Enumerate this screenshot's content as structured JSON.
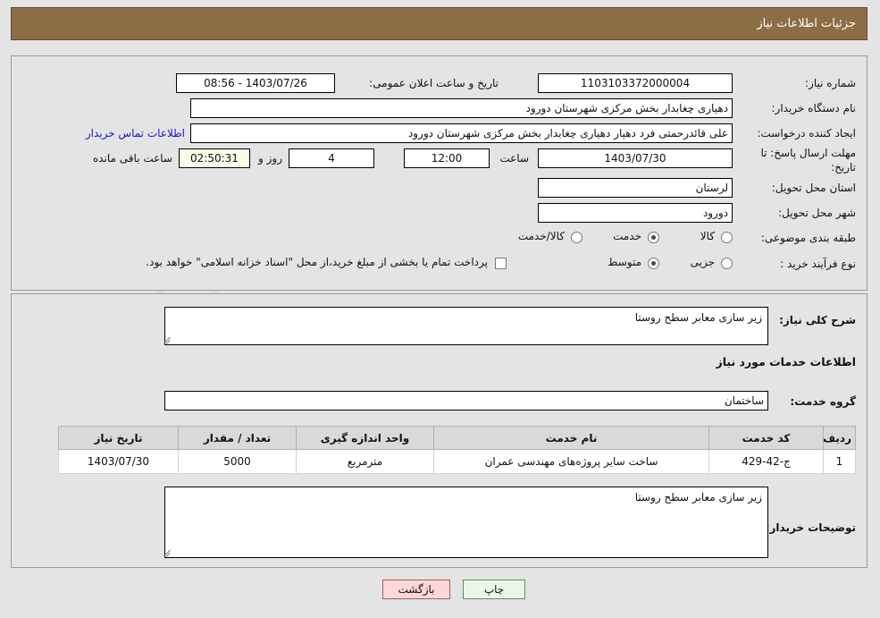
{
  "header": {
    "title": "جزئیات اطلاعات نیاز"
  },
  "form": {
    "need_number_label": "شماره نیاز:",
    "need_number_value": "1103103372000004",
    "announce_datetime_label": "تاریخ و ساعت اعلان عمومی:",
    "announce_datetime_value": "1403/07/26 - 08:56",
    "buyer_org_label": "نام دستگاه خریدار:",
    "buyer_org_value": "دهیاری چغابدار بخش مرکزی شهرستان دورود",
    "creator_label": "ایجاد کننده درخواست:",
    "creator_value": "علی قائدرحمتی فرد دهیار دهیاری چغابدار بخش مرکزی شهرستان دورود",
    "buyer_contact_link": "اطلاعات تماس خریدار",
    "deadline_label": "مهلت ارسال پاسخ: تا تاریخ:",
    "deadline_date_value": "1403/07/30",
    "deadline_hour_label": "ساعت",
    "deadline_hour_value": "12:00",
    "remaining_days_value": "4",
    "remaining_days_label": "روز و",
    "remaining_time_value": "02:50:31",
    "remaining_time_label": "ساعت باقی مانده",
    "province_label": "استان محل تحویل:",
    "province_value": "لرستان",
    "city_label": "شهر محل تحویل:",
    "city_value": "دورود",
    "category_label": "طبقه بندی موضوعی:",
    "category_options": [
      "کالا",
      "خدمت",
      "کالا/خدمت"
    ],
    "category_selected": "خدمت",
    "process_label": "نوع فرآیند خرید :",
    "process_options": [
      "جزیی",
      "متوسط"
    ],
    "process_selected": "متوسط",
    "treasury_note": "پرداخت تمام یا بخشی از مبلغ خرید،از محل \"اسناد خزانه اسلامی\" خواهد بود.",
    "treasury_checked": false
  },
  "details": {
    "general_desc_label": "شرح کلی نیاز:",
    "general_desc_value": "زیر سازی معابر سطح روستا",
    "services_section_title": "اطلاعات خدمات مورد نیاز",
    "service_group_label": "گروه خدمت:",
    "service_group_value": "ساختمان",
    "buyer_notes_label": "توضیحات خریدار:",
    "buyer_notes_value": "زیر سازی معابر سطح روستا"
  },
  "table": {
    "columns": [
      "ردیف",
      "کد خدمت",
      "نام خدمت",
      "واحد اندازه گیری",
      "تعداد / مقدار",
      "تاریخ نیاز"
    ],
    "rows": [
      {
        "index": "1",
        "service_code": "ج-42-429",
        "service_name": "ساخت سایر پروژه‌های مهندسی عمران",
        "unit": "مترمربع",
        "quantity": "5000",
        "need_date": "1403/07/30"
      }
    ]
  },
  "footer": {
    "print_label": "چاپ",
    "back_label": "بازگشت"
  },
  "watermark": {
    "text": "AnaTender.net"
  },
  "colors": {
    "header_bg": "#8c6d46",
    "page_bg": "#e4e4e4",
    "link": "#1717d4",
    "countdown_bg": "#fbfbe8",
    "print_btn_bg": "#e9f7e9",
    "back_btn_bg": "#fbd7d7",
    "table_header_bg": "#d9d9d9"
  }
}
